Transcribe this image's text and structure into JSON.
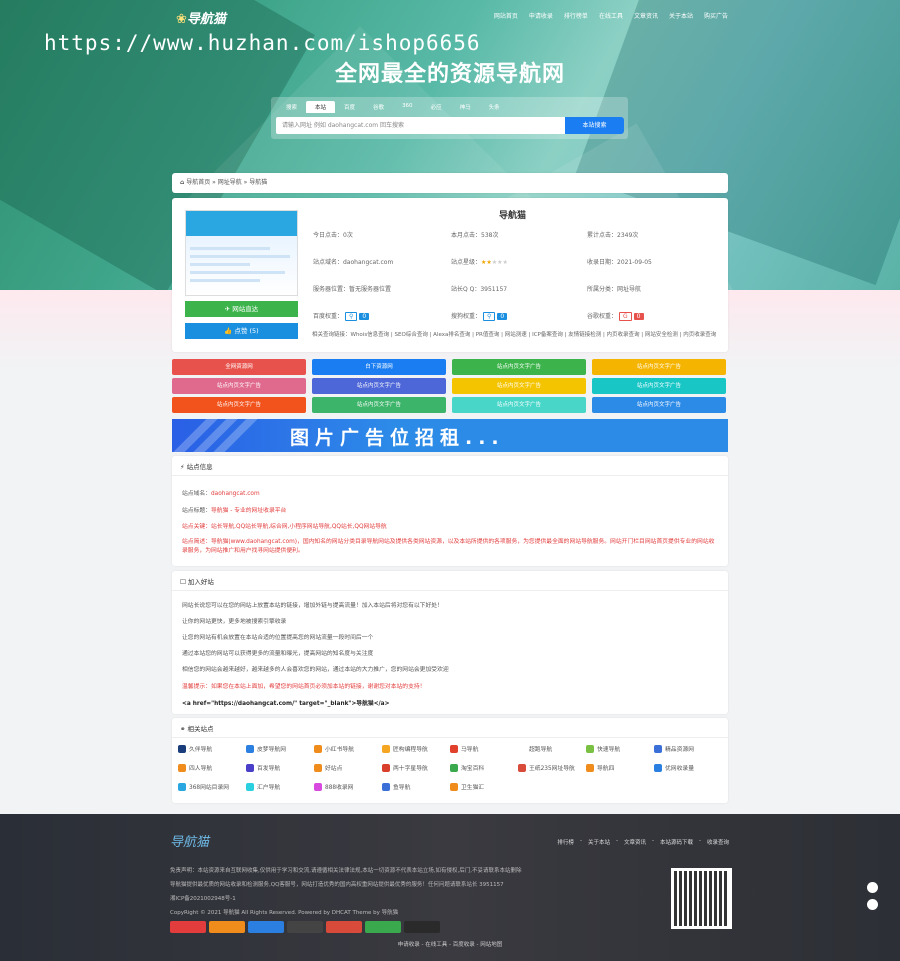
{
  "header": {
    "logo": "导航猫",
    "nav": [
      "网站首页",
      "申请收录",
      "排行榜单",
      "在线工具",
      "文章资讯",
      "关于本站",
      "购买广告"
    ],
    "watermark": "https://www.huzhan.com/ishop6656",
    "hero_title": "全网最全的资源导航网"
  },
  "search": {
    "tabs": [
      "搜索",
      "本站",
      "百度",
      "谷歌",
      "360",
      "必应",
      "神马",
      "头条"
    ],
    "active_tab": "本站",
    "placeholder": "请输入网址 例如 daohangcat.com 回车搜索",
    "button": "本站搜索"
  },
  "breadcrumb": {
    "icon": "home-icon",
    "text": "导航首页 » 网址导航 » 导航猫"
  },
  "site": {
    "name": "导航猫",
    "visit_button": "网站直达",
    "like_button": "点赞 (5)",
    "today_clicks": "今日点击：0次",
    "month_clicks": "本月点击：538次",
    "total_clicks": "累计点击：2349次",
    "domain": "站点域名：daohangcat.com",
    "rating_label": "站点星级：",
    "rating": 2,
    "date": "收录日期：2021-09-05",
    "location": "服务器位置：暂无服务器位置",
    "qq": "站长Q Q：3951157",
    "category": "所属分类：网址导航",
    "baidu_weight_label": "百度权重：",
    "baidu_weight": "0",
    "sogou_weight_label": "搜狗权重：",
    "sogou_weight": "0",
    "google_weight_label": "谷歌权重：",
    "google_weight": "0",
    "query_links": "相关查询链接：Whois信息查询 | SEO综合查询 | Alexa排名查询 | PR值查询 | 网站测速 | ICP备案查询 | 友情链接检测 | 内页收录查询 | 网站安全检测 | 内页收录查询"
  },
  "ads": [
    {
      "label": "全网资源网",
      "color": "#e8524c"
    },
    {
      "label": "白下资源网",
      "color": "#1a7ef2"
    },
    {
      "label": "站点内页文字广告",
      "color": "#3cb44b"
    },
    {
      "label": "站点内页文字广告",
      "color": "#f5b400"
    },
    {
      "label": "站点内页文字广告",
      "color": "#e06a8e"
    },
    {
      "label": "站点内页文字广告",
      "color": "#4d66d8"
    },
    {
      "label": "站点内页文字广告",
      "color": "#f5c400"
    },
    {
      "label": "站点内页文字广告",
      "color": "#18c6c6"
    },
    {
      "label": "站点内页文字广告",
      "color": "#f2531c"
    },
    {
      "label": "站点内页文字广告",
      "color": "#3cb46a"
    },
    {
      "label": "站点内页文字广告",
      "color": "#47d6c8"
    },
    {
      "label": "站点内页文字广告",
      "color": "#2d8be8"
    }
  ],
  "banner": "图片广告位招租...",
  "intro": {
    "title": "站点信息",
    "line1_label": "站点域名：",
    "line1_value": "daohangcat.com",
    "line2_label": "站点标题：",
    "line2_value": "导航猫 - 专业的网址收录平台",
    "line3": "站点关键：站长导航,QQ站长导航,综合网,小程序网站导航,QQ站长,QQ网站导航",
    "line4a": "站点简述：导航猫(www.daohangcat.com)，国内知名的网站分类目录导航网站及提供各类网站资源，以及本站所提供的各项服务，为您提供最全面的网站导航服务。网站开门栏目",
    "line4b": "网站首页提供专业的网站收录服务，为网站推广和用户找寻网站提供便利。"
  },
  "join": {
    "title": "加入好站",
    "lines": [
      "网站长说您可以在您的网站上放置本站的链接，增加外链与提高流量！加入本站后将对您有以下好处！",
      "让你的网站更快，更多地被搜索引擎收录",
      "让您的网站有机会放置在本站合适的位置提高您的网站流量一段时间后一个",
      "通过本站您的网站可以获得更多的流量和曝光，提高网站的知名度与关注度",
      "相信您的网站会越来越好，越来越多的人会喜欢您的网站，通过本站的大力推广，您的网站会更加受欢迎"
    ],
    "warning": "温馨提示：如果您在本站上面加，希望您的网站首页必须加本站的链接，谢谢您对本站的支持！",
    "code": "<a href=\"https://daohangcat.com/\" target=\"_blank\">导航猫</a>"
  },
  "related": {
    "title": "相关站点",
    "items": [
      {
        "label": "久伴导航",
        "icon": "#1a3d7c"
      },
      {
        "label": "皮梦导航网",
        "icon": "#2a7fe0"
      },
      {
        "label": "小红书导航",
        "icon": "#f08c1c"
      },
      {
        "label": "匠构编程导航",
        "icon": "#f5a623"
      },
      {
        "label": "马导航",
        "icon": "#e0402c"
      },
      {
        "label": "超跑导航",
        "icon": "#ffffff"
      },
      {
        "label": "快速导航",
        "icon": "#7ac143"
      },
      {
        "label": "精品资源网",
        "icon": "#3a6fd8"
      },
      {
        "label": "四人导航",
        "icon": "#f08c1c"
      },
      {
        "label": "百发导航",
        "icon": "#4a3fc8"
      },
      {
        "label": "好站点",
        "icon": "#f08c1c"
      },
      {
        "label": "两十字星导航",
        "icon": "#d8402c"
      },
      {
        "label": "淘宝百科",
        "icon": "#3aa84c"
      },
      {
        "label": "王纸235网址导航",
        "icon": "#d84a3a"
      },
      {
        "label": "导航四",
        "icon": "#f08c1c"
      },
      {
        "label": "优网收录量",
        "icon": "#2a7fe0"
      },
      {
        "label": "368网站目录网",
        "icon": "#2aa7e0"
      },
      {
        "label": "汇户导航",
        "icon": "#2ad0e0"
      },
      {
        "label": "888收录网",
        "icon": "#d84adf"
      },
      {
        "label": "鱼导航",
        "icon": "#3a6fd8"
      },
      {
        "label": "卫生猫汇",
        "icon": "#f08c1c"
      }
    ]
  },
  "footer": {
    "logo": "导航猫",
    "nav": [
      "排行榜",
      "关于本站",
      "文章资讯",
      "本站源码下载",
      "收录查询"
    ],
    "disclaimer": "免责声明：本站资源来自互联网收集,仅供用于学习和交流,请遵循相关法律法规,本站一切资源不代表本站立场,如有侵权,后门,不妥请联系本站删除",
    "contact": "导航猫提供最优质的网站收录和检测服务,QQ客服号，网站打造优秀的国内高权重网站提供最优秀的服务！任何问题请联系站长 3951157",
    "icp": "湘ICP备2021002948号-1",
    "copyright": "CopyRight © 2021 导航猫 All Rights Reserved. Powered by DHCAT Theme by 导航猫",
    "bottom_links": "申请收录 - 在线工具 - 百度收录 - 网站地图"
  }
}
